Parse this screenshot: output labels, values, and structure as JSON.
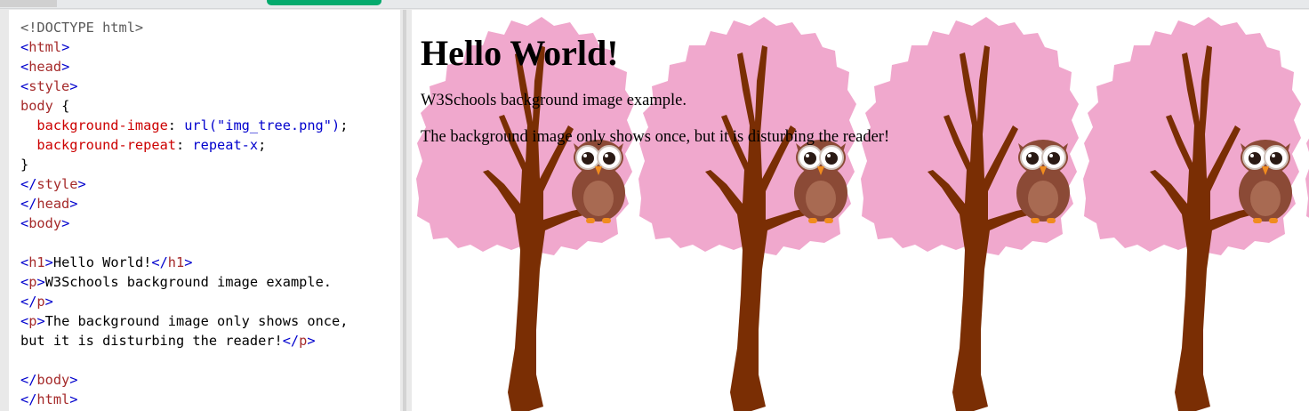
{
  "colors": {
    "run_button": "#04aa6d",
    "tag": "#a52a2a",
    "bracket": "#0000cd",
    "property": "#cc0000",
    "value": "#0000cd",
    "blossom": "#f0a8cd",
    "trunk": "#7a2e04",
    "owl_body": "#8b4a36"
  },
  "code": {
    "l1_doctype": "<!DOCTYPE html>",
    "l2_html": "html",
    "l3_head": "head",
    "l4_style": "style",
    "l5_selector": "body",
    "l5_brace": "{",
    "l6_prop": "background-image",
    "l6_value": "url(\"img_tree.png\")",
    "l7_prop": "background-repeat",
    "l7_value": "repeat-x",
    "l8_brace": "}",
    "l9_style_close": "style",
    "l10_head_close": "head",
    "l11_body": "body",
    "l13_h1": "h1",
    "l13_text": "Hello World!",
    "l13_h1_close": "h1",
    "l14_p": "p",
    "l14_text": "W3Schools background image example.",
    "l15_p_close": "p",
    "l16_p": "p",
    "l16_text": "The background image only shows once,",
    "l17_text": "but it is disturbing the reader!",
    "l17_p_close": "p",
    "l19_body_close": "body",
    "l20_html_close": "html"
  },
  "result": {
    "heading": "Hello World!",
    "paragraph1": "W3Schools background image example.",
    "paragraph2": "The background image only shows once, but it is disturbing the reader!",
    "background_image": "tree-with-owl",
    "background_repeat": "repeat-x"
  }
}
